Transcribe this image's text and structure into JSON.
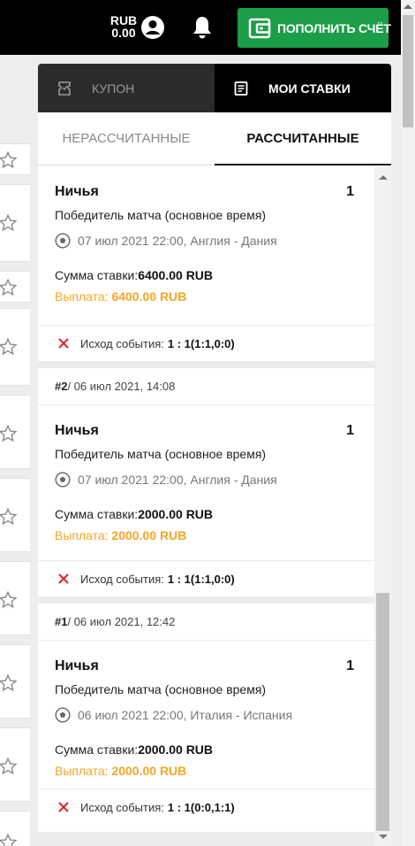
{
  "header": {
    "currency": "RUB",
    "balance": "0.00",
    "deposit_label": "ПОПОЛНИТЬ СЧЁТ"
  },
  "panel": {
    "tabs": {
      "coupon": "КУПОН",
      "my_bets": "МОИ СТАВКИ"
    },
    "subtabs": {
      "unsettled": "НЕРАССЧИТАННЫЕ",
      "settled": "РАССЧИТАННЫЕ"
    },
    "labels": {
      "stake": "Сумма ставки:",
      "payout": "Выплата: ",
      "result": "Исход события:"
    },
    "bets": [
      {
        "outcome": "Ничья",
        "coef": "1",
        "market": "Победитель матча (основное время)",
        "event": "07 июл 2021 22:00, Англия - Дания",
        "stake": "6400.00 RUB",
        "payout": "6400.00 RUB",
        "result": "1 : 1(1:1,0:0)"
      },
      {
        "number": "#2",
        "date": " / 06 июл 2021, 14:08",
        "outcome": "Ничья",
        "coef": "1",
        "market": "Победитель матча (основное время)",
        "event": "07 июл 2021 22:00, Англия - Дания",
        "stake": "2000.00 RUB",
        "payout": "2000.00 RUB",
        "result": "1 : 1(1:1,0:0)"
      },
      {
        "number": "#1",
        "date": " / 06 июл 2021, 12:42",
        "outcome": "Ничья",
        "coef": "1",
        "market": "Победитель матча (основное время)",
        "event": "06 июл 2021 22:00, Италия - Испания",
        "stake": "2000.00 RUB",
        "payout": "2000.00 RUB",
        "result": "1 : 1(0:0,1:1)"
      }
    ]
  },
  "colors": {
    "topbar": "#000000",
    "deposit_button": "#1c9d48",
    "payout": "#f5a623",
    "lost_mark": "#d9232d"
  }
}
